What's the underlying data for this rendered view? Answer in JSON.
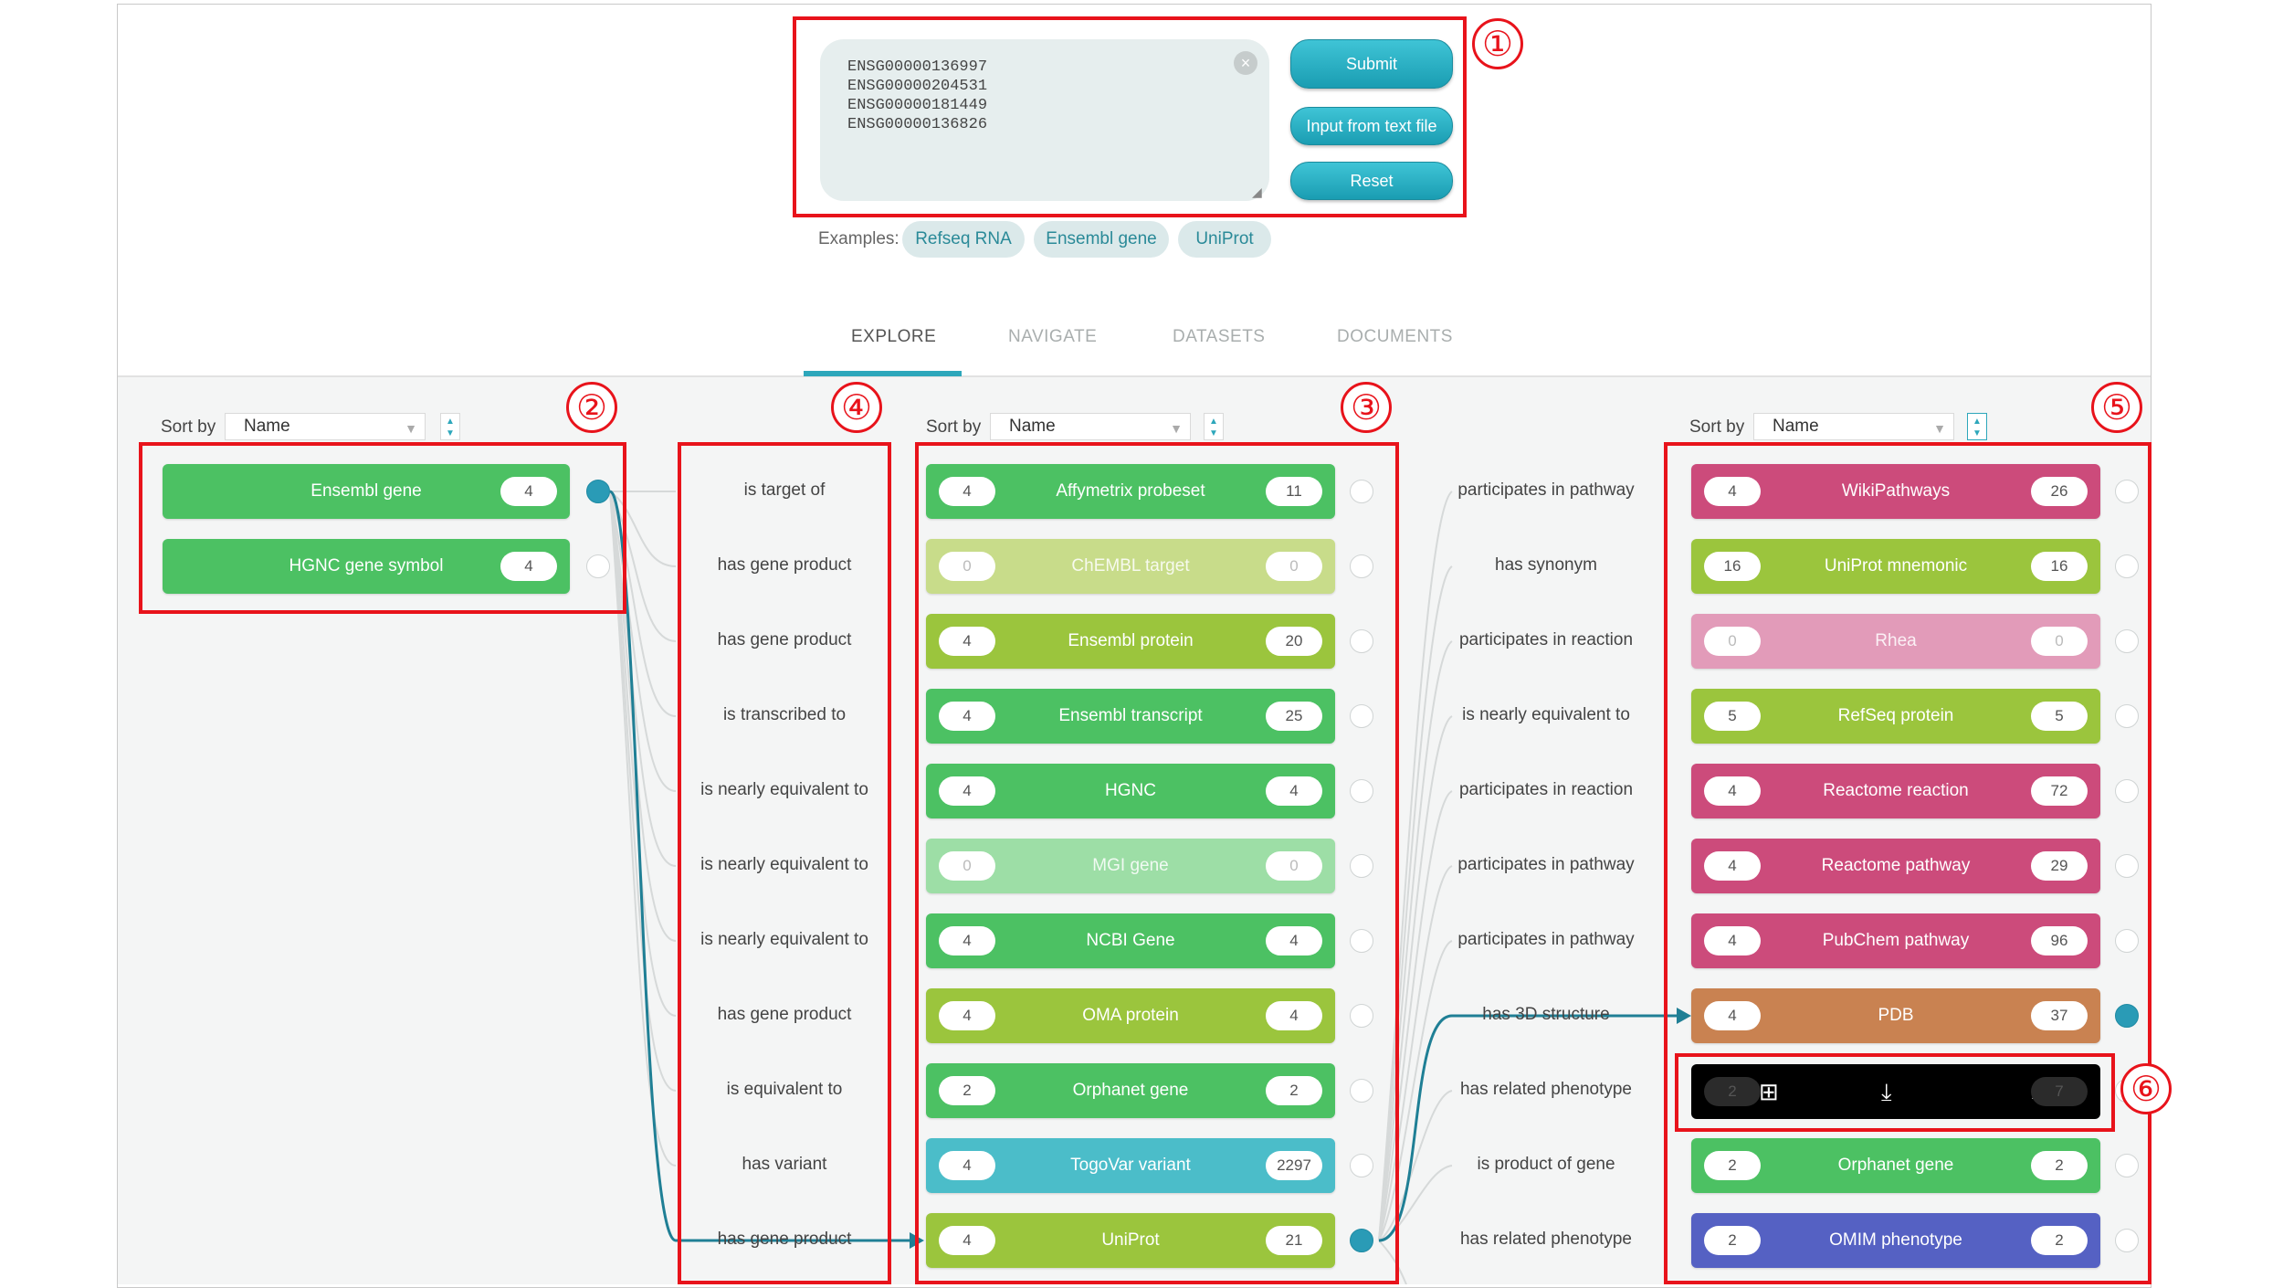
{
  "input": {
    "ids": [
      "ENSG00000136997",
      "ENSG00000204531",
      "ENSG00000181449",
      "ENSG00000136826"
    ],
    "buttons": {
      "submit": "Submit",
      "from_file": "Input from text file",
      "reset": "Reset"
    },
    "examples_label": "Examples:",
    "examples": [
      "Refseq RNA",
      "Ensembl gene",
      "UniProt"
    ]
  },
  "tabs": [
    "EXPLORE",
    "NAVIGATE",
    "DATASETS",
    "DOCUMENTS"
  ],
  "active_tab": "EXPLORE",
  "sort": {
    "label": "Sort by",
    "value": "Name"
  },
  "source_column": [
    {
      "name": "Ensembl gene",
      "count": "4",
      "color": "#4cc163",
      "selected": true
    },
    {
      "name": "HGNC gene symbol",
      "count": "4",
      "color": "#4cc163",
      "selected": false
    }
  ],
  "relations_1": [
    "is target of",
    "has gene product",
    "has gene product",
    "is transcribed to",
    "is nearly equivalent to",
    "is nearly equivalent to",
    "is nearly equivalent to",
    "has gene product",
    "is equivalent to",
    "has variant",
    "has gene product"
  ],
  "middle_column": [
    {
      "left": "4",
      "name": "Affymetrix probeset",
      "right": "11",
      "color": "#4cc163"
    },
    {
      "left": "0",
      "name": "ChEMBL target",
      "right": "0",
      "color": "#c8dc8a",
      "dim": true
    },
    {
      "left": "4",
      "name": "Ensembl protein",
      "right": "20",
      "color": "#9bc53d"
    },
    {
      "left": "4",
      "name": "Ensembl transcript",
      "right": "25",
      "color": "#4cc163"
    },
    {
      "left": "4",
      "name": "HGNC",
      "right": "4",
      "color": "#4cc163"
    },
    {
      "left": "0",
      "name": "MGI gene",
      "right": "0",
      "color": "#9ddea6",
      "dim": true
    },
    {
      "left": "4",
      "name": "NCBI Gene",
      "right": "4",
      "color": "#4cc163"
    },
    {
      "left": "4",
      "name": "OMA protein",
      "right": "4",
      "color": "#9bc53d"
    },
    {
      "left": "2",
      "name": "Orphanet gene",
      "right": "2",
      "color": "#4cc163"
    },
    {
      "left": "4",
      "name": "TogoVar variant",
      "right": "2297",
      "color": "#4bbdc9"
    },
    {
      "left": "4",
      "name": "UniProt",
      "right": "21",
      "color": "#9bc53d",
      "selected": true
    }
  ],
  "relations_2": [
    "participates in pathway",
    "has synonym",
    "participates in reaction",
    "is nearly equivalent to",
    "participates in reaction",
    "participates in pathway",
    "participates in pathway",
    "has 3D structure",
    "has related phenotype",
    "is product of gene",
    "has related phenotype"
  ],
  "right_column": [
    {
      "left": "4",
      "name": "WikiPathways",
      "right": "26",
      "color": "#cc4b7b"
    },
    {
      "left": "16",
      "name": "UniProt mnemonic",
      "right": "16",
      "color": "#9bc53d"
    },
    {
      "left": "0",
      "name": "Rhea",
      "right": "0",
      "color": "#e29bb9",
      "dim": true
    },
    {
      "left": "5",
      "name": "RefSeq protein",
      "right": "5",
      "color": "#9bc53d"
    },
    {
      "left": "4",
      "name": "Reactome reaction",
      "right": "72",
      "color": "#cc4b7b"
    },
    {
      "left": "4",
      "name": "Reactome pathway",
      "right": "29",
      "color": "#cc4b7b"
    },
    {
      "left": "4",
      "name": "PubChem pathway",
      "right": "96",
      "color": "#cc4b7b"
    },
    {
      "left": "4",
      "name": "PDB",
      "right": "37",
      "color": "#c98251",
      "selected": true
    },
    {
      "left": "2",
      "name": "",
      "right": "7",
      "color": "#000000",
      "toolbar": true
    },
    {
      "left": "2",
      "name": "Orphanet gene",
      "right": "2",
      "color": "#4cc163"
    },
    {
      "left": "2",
      "name": "OMIM phenotype",
      "right": "2",
      "color": "#5561c3"
    }
  ],
  "toolbar_icons": [
    "table-icon",
    "download-icon",
    "info-icon"
  ],
  "callouts": [
    "①",
    "②",
    "③",
    "④",
    "⑤",
    "⑥"
  ],
  "colors": {
    "accent": "#2da7bb",
    "annotation": "#e8131b"
  }
}
